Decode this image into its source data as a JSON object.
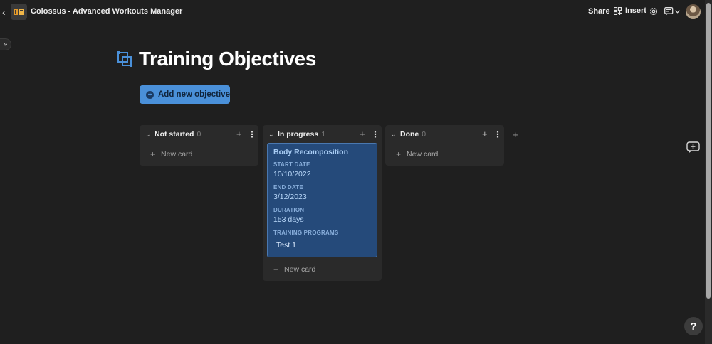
{
  "app": {
    "doc_title": "Colossus - Advanced Workouts Manager",
    "share_label": "Share",
    "insert_label": "Insert"
  },
  "page": {
    "title": "Training Objectives",
    "add_button_label": "Add new objective"
  },
  "board": {
    "columns": [
      {
        "name": "Not started",
        "count": "0",
        "new_card_label": "New card"
      },
      {
        "name": "In progress",
        "count": "1",
        "new_card_label": "New card"
      },
      {
        "name": "Done",
        "count": "0",
        "new_card_label": "New card"
      }
    ],
    "card": {
      "title": "Body Recomposition",
      "fields": [
        {
          "label": "START DATE",
          "value": "10/10/2022"
        },
        {
          "label": "END DATE",
          "value": "3/12/2023"
        },
        {
          "label": "DURATION",
          "value": "153 days"
        },
        {
          "label": "TRAINING PROGRAMS",
          "value": "Test 1"
        }
      ]
    }
  },
  "help_label": "?",
  "colors": {
    "background": "#1f1f1f",
    "column_bg": "#2a2a2a",
    "accent": "#4a90d9",
    "card_bg": "#254a7a"
  }
}
